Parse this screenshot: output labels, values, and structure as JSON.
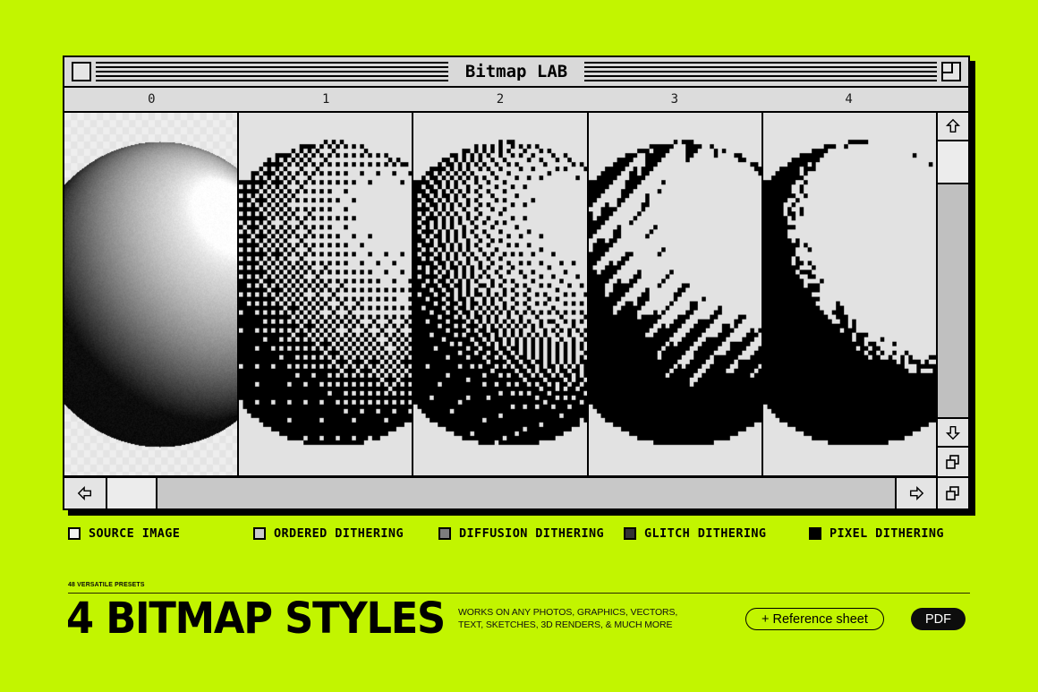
{
  "page": {
    "background_color": "#c2f500"
  },
  "window": {
    "title": "Bitmap LAB",
    "close_box": "close-box",
    "zoom_box": "zoom-box",
    "column_headers": [
      "0",
      "1",
      "2",
      "3",
      "4"
    ],
    "panels": [
      {
        "index": 0,
        "style": "source",
        "label": "SOURCE IMAGE",
        "transparent": true
      },
      {
        "index": 1,
        "style": "ordered",
        "label": "ORDERED DITHERING",
        "transparent": false
      },
      {
        "index": 2,
        "style": "diffusion",
        "label": "DIFFUSION DITHERING",
        "transparent": false
      },
      {
        "index": 3,
        "style": "glitch",
        "label": "GLITCH DITHERING",
        "transparent": false
      },
      {
        "index": 4,
        "style": "pixel",
        "label": "PIXEL DITHERING",
        "transparent": false
      }
    ],
    "scrollbars": {
      "up_arrow": "arrow-up-icon",
      "down_arrow": "arrow-down-icon",
      "left_arrow": "arrow-left-icon",
      "right_arrow": "arrow-right-icon",
      "grow_box": "resize-grow-icon"
    }
  },
  "legend": {
    "items": [
      {
        "label": "SOURCE  IMAGE",
        "color": "#f2f2f2"
      },
      {
        "label": "ORDERED  DITHERING",
        "color": "#c9c9c9"
      },
      {
        "label": "DIFFUSION  DITHERING",
        "color": "#7d7d7d"
      },
      {
        "label": "GLITCH  DITHERING",
        "color": "#333333"
      },
      {
        "label": "PIXEL  DITHERING",
        "color": "#000000"
      }
    ]
  },
  "footer": {
    "eyebrow": "48 VERSATILE PRESETS",
    "headline": "4 BITMAP STYLES",
    "subcopy_line1": "WORKS ON ANY PHOTOS, GRAPHICS, VECTORS,",
    "subcopy_line2": "TEXT, SKETCHES, 3D RENDERS, & MUCH MORE",
    "reference_button": "+ Reference sheet",
    "pdf_button": "PDF"
  }
}
